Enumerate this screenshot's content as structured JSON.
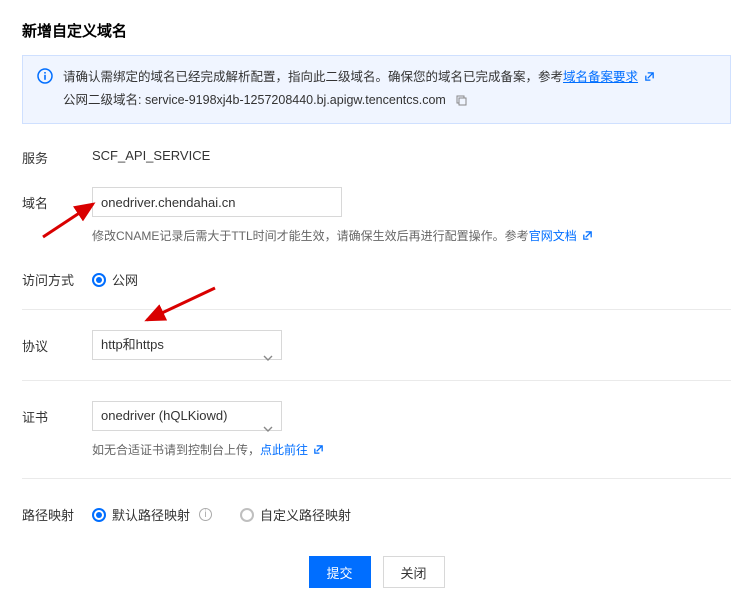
{
  "title": "新增自定义域名",
  "alert": {
    "line1a": "请确认需绑定的域名已经完成解析配置，指向此二级域名。确保您的域名已完成备案，参考",
    "backup_link": "域名备案要求",
    "line2_prefix": "公网二级域名: ",
    "l2_domain": "service-9198xj4b-1257208440.bj.apigw.tencentcs.com"
  },
  "form": {
    "service_label": "服务",
    "service_value": "SCF_API_SERVICE",
    "domain_label": "域名",
    "domain_value": "onedriver.chendahai.cn",
    "domain_hint_a": "修改CNAME记录后需大于TTL时间才能生效，请确保生效后再进行配置操作。参考",
    "domain_hint_link": "官网文档",
    "access_label": "访问方式",
    "access_option_public": "公网",
    "protocol_label": "协议",
    "protocol_value": "http和https",
    "cert_label": "证书",
    "cert_value": "onedriver (hQLKiowd)",
    "cert_hint_a": "如无合适证书请到控制台上传，",
    "cert_hint_link": "点此前往",
    "path_label": "路径映射",
    "path_default": "默认路径映射",
    "path_custom": "自定义路径映射"
  },
  "footer": {
    "submit": "提交",
    "close": "关闭"
  }
}
